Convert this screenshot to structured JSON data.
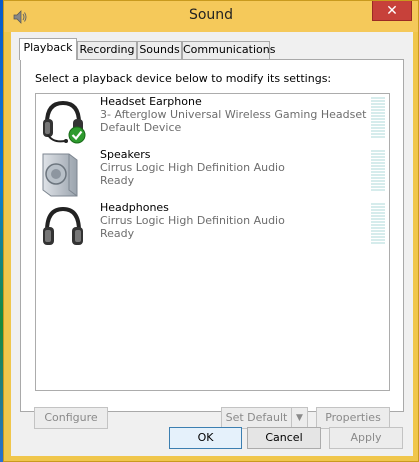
{
  "window": {
    "title": "Sound",
    "close_glyph": "✕"
  },
  "tabs": [
    {
      "label": "Playback",
      "active": true
    },
    {
      "label": "Recording",
      "active": false
    },
    {
      "label": "Sounds",
      "active": false
    },
    {
      "label": "Communications",
      "active": false
    }
  ],
  "playback": {
    "instruction": "Select a playback device below to modify its settings:",
    "devices": [
      {
        "name": "Headset Earphone",
        "description": "3- Afterglow Universal Wireless Gaming Headset",
        "status": "Default Device",
        "icon": "headset-icon",
        "badge": "default-check-icon"
      },
      {
        "name": "Speakers",
        "description": "Cirrus Logic High Definition Audio",
        "status": "Ready",
        "icon": "speaker-icon"
      },
      {
        "name": "Headphones",
        "description": "Cirrus Logic High Definition Audio",
        "status": "Ready",
        "icon": "headphones-icon"
      }
    ],
    "buttons": {
      "configure": "Configure",
      "set_default": "Set Default",
      "properties": "Properties"
    }
  },
  "footer": {
    "ok": "OK",
    "cancel": "Cancel",
    "apply": "Apply"
  },
  "colors": {
    "title_bar": "#f5c95a",
    "close_button": "#c7413a",
    "check_green": "#2e9b2e"
  }
}
